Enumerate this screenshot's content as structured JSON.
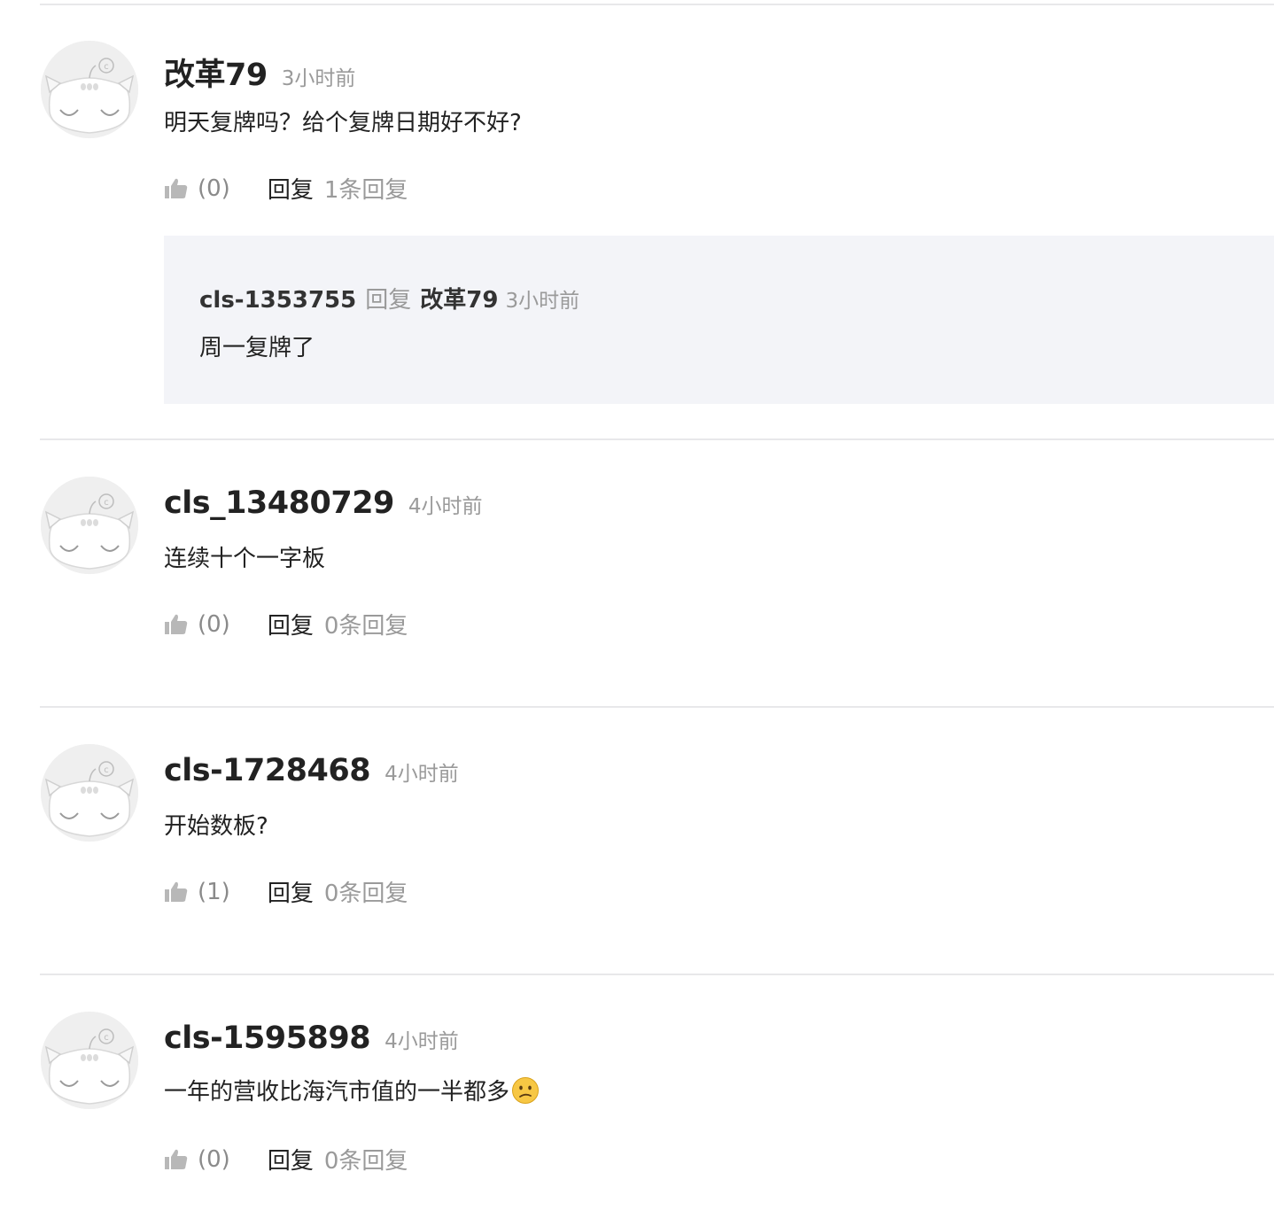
{
  "comments": [
    {
      "username": "改革79",
      "time": "3小时前",
      "text": "明天复牌吗？给个复牌日期好不好?",
      "likes": "(0)",
      "reply_label": "回复",
      "reply_count": "1条回复",
      "replies": [
        {
          "username": "cls-1353755",
          "reply_word": "回复",
          "target": "改革79",
          "time": "3小时前",
          "text": "周一复牌了"
        }
      ]
    },
    {
      "username": "cls_13480729",
      "time": "4小时前",
      "text": "连续十个一字板",
      "likes": "(0)",
      "reply_label": "回复",
      "reply_count": "0条回复"
    },
    {
      "username": "cls-1728468",
      "time": "4小时前",
      "text": "开始数板?",
      "likes": "(1)",
      "reply_label": "回复",
      "reply_count": "0条回复"
    },
    {
      "username": "cls-1595898",
      "time": "4小时前",
      "text": "一年的营收比海汽市值的一半都多",
      "emoji": "confused-face-emoji",
      "likes": "(0)",
      "reply_label": "回复",
      "reply_count": "0条回复"
    }
  ],
  "icons": {
    "like": "thumbs-up-icon",
    "avatar": "default-cat-avatar"
  },
  "colors": {
    "divider": "#e8e8ea",
    "reply_background": "#f3f4f8",
    "muted_text": "#9a9a9a"
  }
}
